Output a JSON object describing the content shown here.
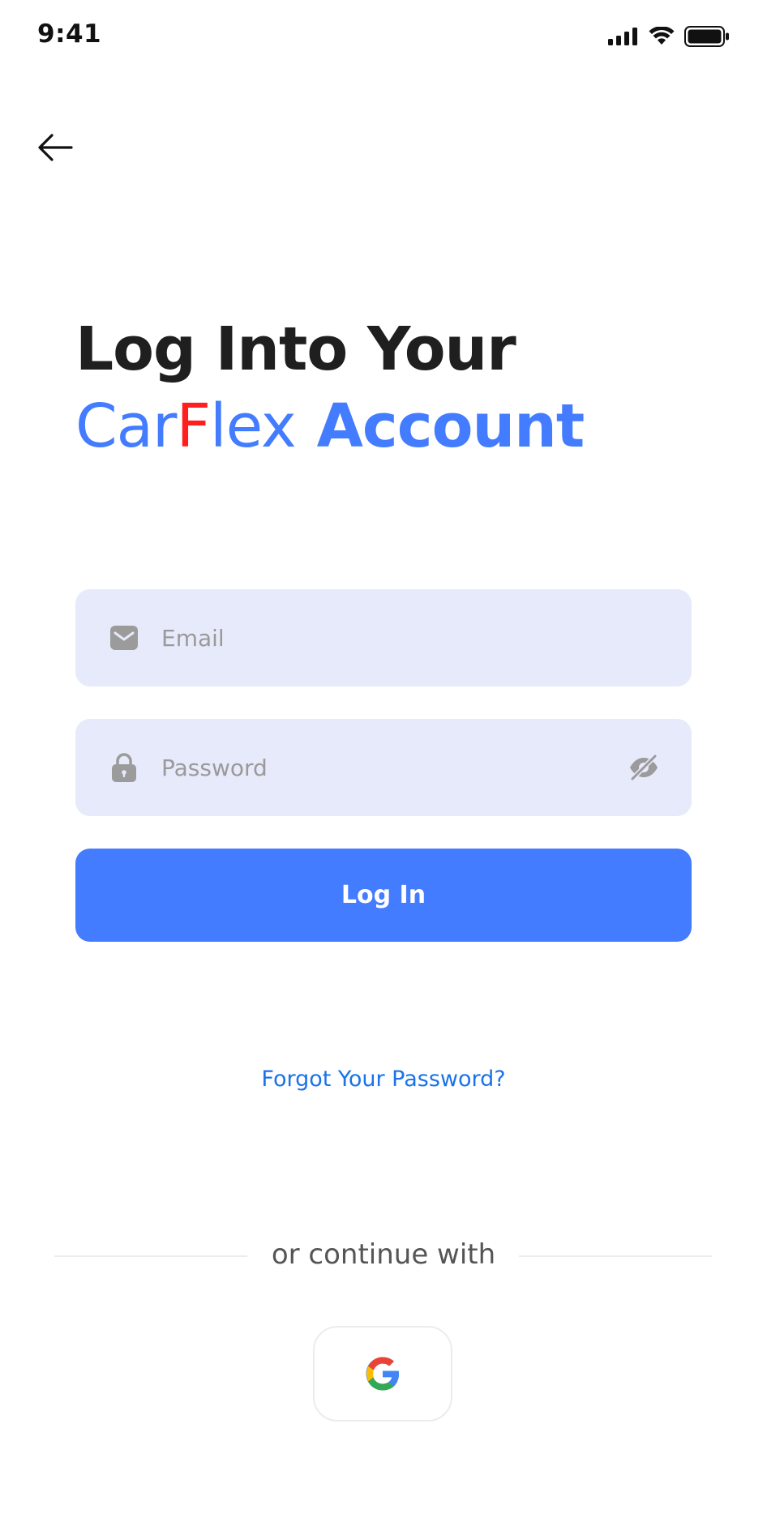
{
  "status_bar": {
    "time": "9:41"
  },
  "nav": {
    "back_icon": "arrow-left-icon"
  },
  "heading": {
    "line1": "Log Into Your",
    "brand_part1": "Car",
    "brand_part2": "F",
    "brand_part3": "lex",
    "line2_suffix": "Account"
  },
  "form": {
    "email": {
      "placeholder": "Email",
      "value": "",
      "icon": "mail-icon"
    },
    "password": {
      "placeholder": "Password",
      "value": "",
      "icon": "lock-icon",
      "toggle_icon": "eye-off-icon"
    },
    "login_label": "Log In",
    "forgot_label": "Forgot Your Password?"
  },
  "social": {
    "divider_text": "or continue with",
    "google_icon": "google-icon"
  },
  "colors": {
    "primary": "#437cfe",
    "brand_red": "#ff1f1f",
    "input_bg": "#e6eafb",
    "link": "#1a73e8"
  }
}
